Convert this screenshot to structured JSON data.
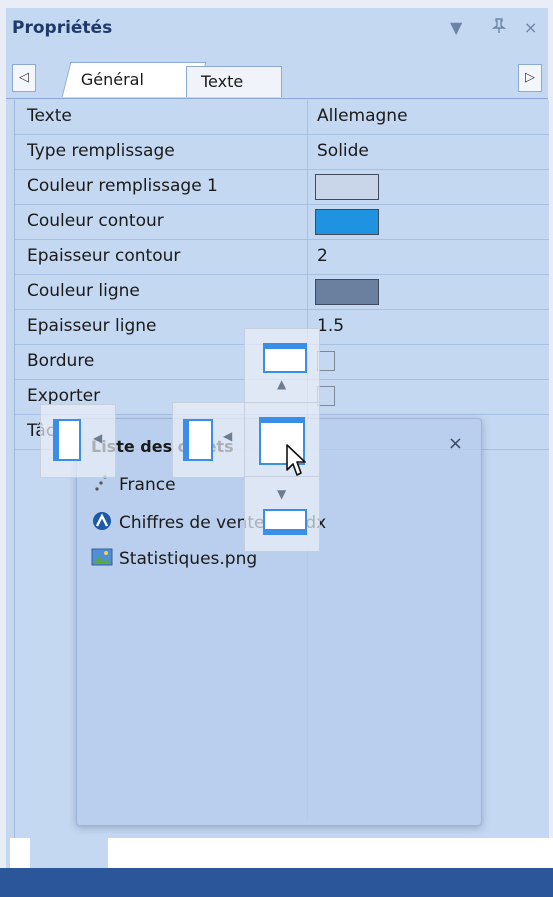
{
  "panel": {
    "title": "Propriétés",
    "icons": {
      "dropdown": "▼",
      "pin": "ᵖ",
      "close": "×"
    },
    "tabs": [
      {
        "label": "Général",
        "active": true
      },
      {
        "label": "Texte",
        "active": false
      }
    ],
    "scroll_left": "◁",
    "scroll_right": "▷"
  },
  "properties": [
    {
      "name": "Texte",
      "value": "Allemagne"
    },
    {
      "name": "Type remplissage",
      "value": "Solide"
    },
    {
      "name": "Couleur remplissage 1",
      "swatch": "#c9d5e8"
    },
    {
      "name": "Couleur contour",
      "swatch": "#1f93e0"
    },
    {
      "name": "Epaisseur contour",
      "value": "2"
    },
    {
      "name": "Couleur ligne",
      "swatch": "#6b7f9e"
    },
    {
      "name": "Epaisseur ligne",
      "value": "1.5"
    },
    {
      "name": "Bordure",
      "value": ""
    },
    {
      "name": "Exporter",
      "value": ""
    },
    {
      "name": "Tâche",
      "value": ""
    }
  ],
  "floating_window": {
    "title": "Liste des objets",
    "close": "×",
    "items": [
      {
        "label": "France",
        "icon": "shape-icon"
      },
      {
        "label": "Chiffres de ventes.mvdx",
        "icon": "chart-file-icon"
      },
      {
        "label": "Statistiques.png",
        "icon": "image-file-icon"
      }
    ]
  },
  "colors": {
    "panel_bg": "#c5d8f1",
    "accent": "#2b579a",
    "dock_blue": "#3a8ee8"
  }
}
